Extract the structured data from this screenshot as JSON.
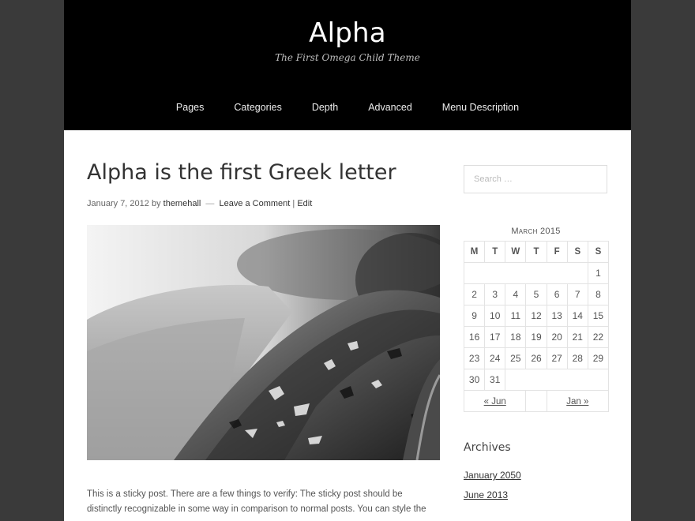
{
  "site": {
    "title": "Alpha",
    "description": "The First Omega Child Theme"
  },
  "nav": {
    "items": [
      "Pages",
      "Categories",
      "Depth",
      "Advanced",
      "Menu Description"
    ]
  },
  "post": {
    "title": "Alpha is the first Greek letter",
    "date": "January 7, 2012",
    "by": "by",
    "author": "themehall",
    "dash": "—",
    "comment_link": "Leave a Comment",
    "pipe": "|",
    "edit_link": "Edit",
    "summary": "This is a sticky post. There are a few things to verify: The sticky post should be distinctly recognizable in some way in comparison to normal posts. You can style the"
  },
  "search": {
    "placeholder": "Search …"
  },
  "calendar": {
    "caption": "March 2015",
    "days": [
      "M",
      "T",
      "W",
      "T",
      "F",
      "S",
      "S"
    ],
    "weeks": [
      [
        "",
        "",
        "",
        "",
        "",
        "",
        "1"
      ],
      [
        "2",
        "3",
        "4",
        "5",
        "6",
        "7",
        "8"
      ],
      [
        "9",
        "10",
        "11",
        "12",
        "13",
        "14",
        "15"
      ],
      [
        "16",
        "17",
        "18",
        "19",
        "20",
        "21",
        "22"
      ],
      [
        "23",
        "24",
        "25",
        "26",
        "27",
        "28",
        "29"
      ],
      [
        "30",
        "31",
        "",
        "",
        "",
        "",
        ""
      ]
    ],
    "prev": "« Jun",
    "next": "Jan »"
  },
  "archives": {
    "title": "Archives",
    "items": [
      "January 2050",
      "June 2013"
    ]
  },
  "colors": {
    "header_bg": "#000000",
    "page_bg": "#3a3a3a",
    "content_bg": "#ffffff"
  }
}
